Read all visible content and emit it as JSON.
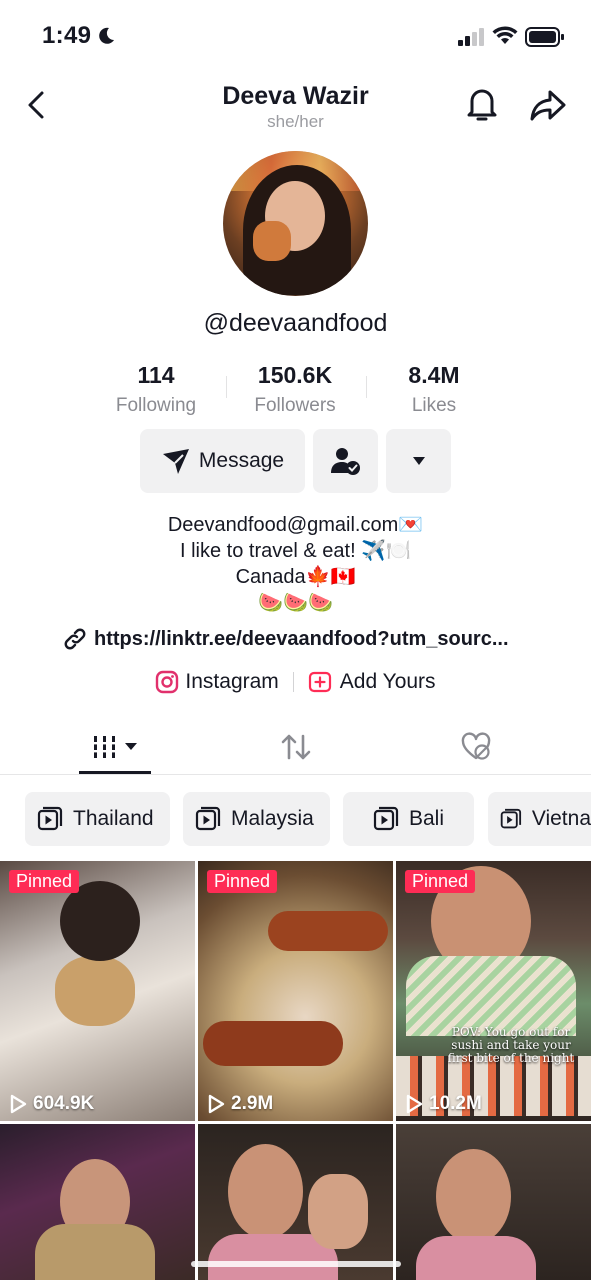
{
  "status_bar": {
    "time": "1:49"
  },
  "header": {
    "title": "Deeva Wazir",
    "pronouns": "she/her"
  },
  "profile": {
    "handle": "@deevaandfood",
    "stats": [
      {
        "value": "114",
        "label": "Following"
      },
      {
        "value": "150.6K",
        "label": "Followers"
      },
      {
        "value": "8.4M",
        "label": "Likes"
      }
    ],
    "message_label": "Message",
    "bio_lines": [
      "Deevandfood@gmail.com💌",
      "I like to travel & eat! ✈️🍽️",
      "Canada🍁🇨🇦",
      "🍉🍉🍉"
    ],
    "link": "https://linktr.ee/deevaandfood?utm_sourc...",
    "social": [
      {
        "label": "Instagram"
      },
      {
        "label": "Add Yours"
      }
    ]
  },
  "playlists": [
    {
      "label": "Thailand"
    },
    {
      "label": "Malaysia"
    },
    {
      "label": "Bali"
    },
    {
      "label": "Vietna"
    }
  ],
  "videos": [
    {
      "pinned": "Pinned",
      "views": "604.9K"
    },
    {
      "pinned": "Pinned",
      "views": "2.9M"
    },
    {
      "pinned": "Pinned",
      "views": "10.2M",
      "caption": "POV: You go out for sushi and take your first bite of the night"
    },
    {
      "views": ""
    },
    {
      "views": ""
    },
    {
      "views": ""
    }
  ],
  "colors": {
    "accent": "#fe2c55",
    "text": "#161823",
    "muted": "#8a8b91",
    "button_bg": "#f1f1f2"
  }
}
